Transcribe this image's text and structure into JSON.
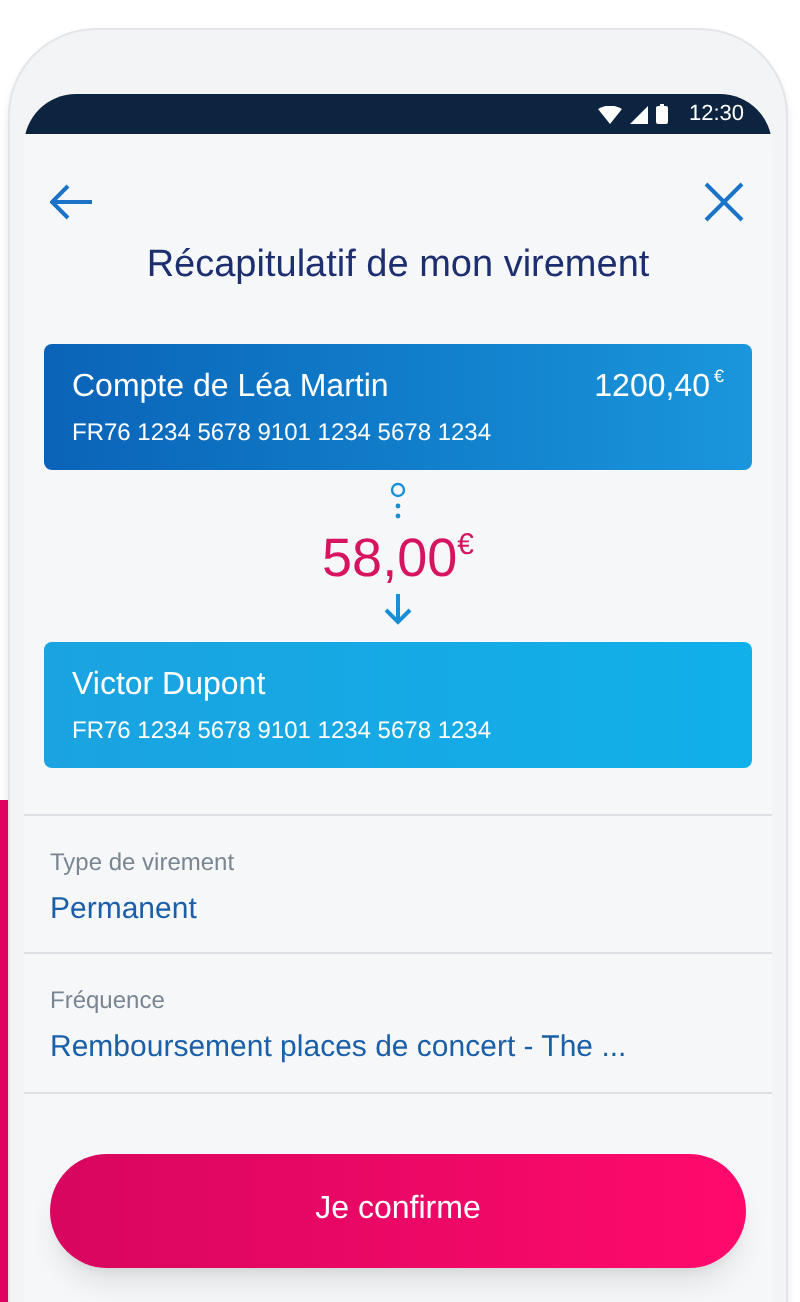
{
  "status_bar": {
    "time": "12:30"
  },
  "header": {
    "title": "Récapitulatif de mon virement"
  },
  "from_account": {
    "name": "Compte de Léa Martin",
    "balance": "1200,40",
    "currency": "€",
    "iban": "FR76 1234 5678 9101 1234 5678 1234"
  },
  "amount": {
    "value": "58,00",
    "currency": "€"
  },
  "to_account": {
    "name": "Victor Dupont",
    "iban": "FR76 1234 5678 9101 1234 5678 1234"
  },
  "fields": [
    {
      "label": "Type de virement",
      "value": "Permanent"
    },
    {
      "label": "Fréquence",
      "value": "Remboursement places de concert - The ..."
    }
  ],
  "confirm_button": {
    "label": "Je confirme"
  }
}
